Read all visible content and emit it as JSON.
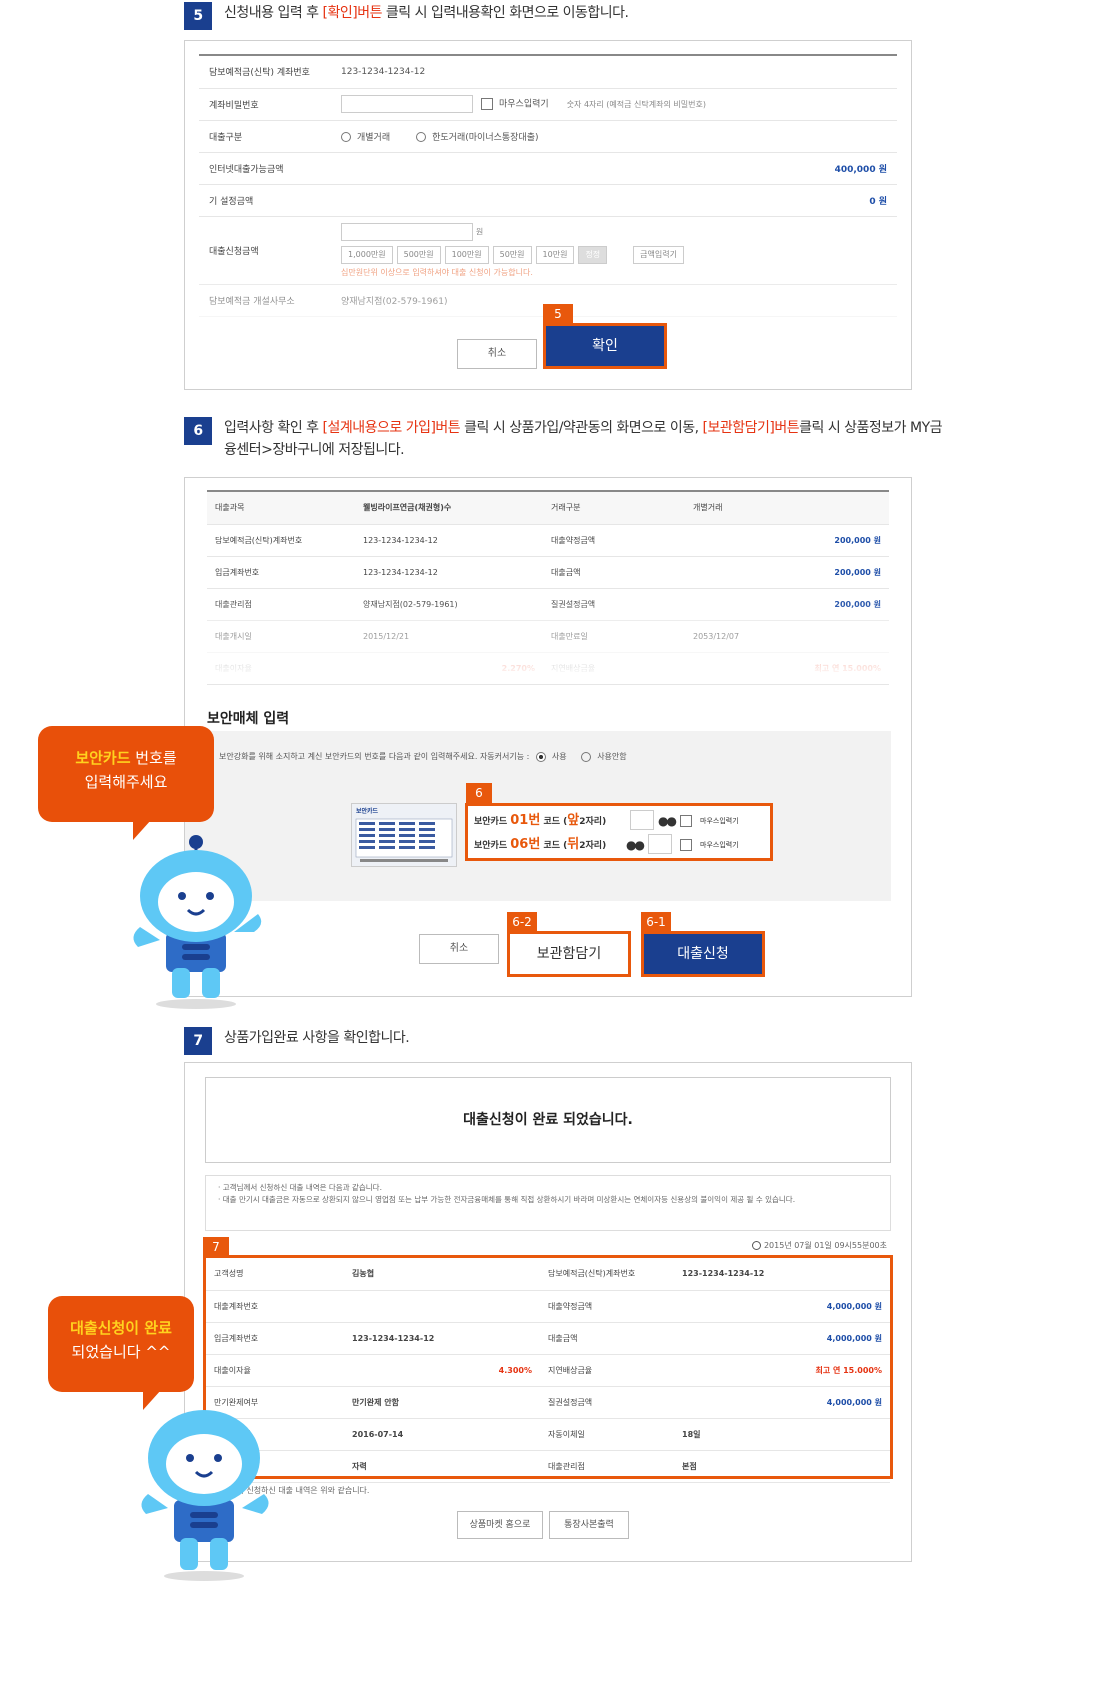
{
  "step5": {
    "num": "5",
    "text_before": "신청내용 입력 후 ",
    "text_highlight": "[확인]버튼",
    "text_after": " 클릭 시 입력내용확인 화면으로 이동합니다."
  },
  "form5": {
    "rows": [
      {
        "label": "담보예적금(신탁) 계좌번호",
        "value": "123-1234-1234-12"
      },
      {
        "label": "계좌비밀번호",
        "mouse": "마우스입력기",
        "hint": "숫자 4자리 (예적금 신탁계좌의 비밀번호)"
      },
      {
        "label": "대출구분",
        "opt1": "개별거래",
        "opt2": "한도거래(마이너스통장대출)"
      },
      {
        "label": "인터넷대출가능금액",
        "value": "400,000 원"
      },
      {
        "label": "기 설정금액",
        "value": "0 원"
      },
      {
        "label": "대출신청금액",
        "unit": "원",
        "amounts": [
          "1,000만원",
          "500만원",
          "100만원",
          "50만원",
          "10만원",
          "정정"
        ],
        "amount_input": "금액입력기",
        "note": "십만원단위 이상으로 입력하셔야 대출 신청이 가능합니다."
      },
      {
        "label": "담보예적금 개설사무소",
        "value": "양재남지점(02-579-1961)"
      }
    ],
    "tag": "5",
    "cancel": "취소",
    "confirm": "확인"
  },
  "step6": {
    "num": "6",
    "t1": "입력사항 확인 후 ",
    "h1": "[설계내용으로 가입]버튼",
    "t2": " 클릭 시 상품가입/약관동의 화면으로 이동, ",
    "h2": "[보관함담기]버튼",
    "t3": "클릭 시 상품정보가 MY금융센터>장바구니에 저장됩니다."
  },
  "form6": {
    "rows": [
      [
        "대출과목",
        "웰빙라이프연금(채권형)수",
        "거래구분",
        "개별거래"
      ],
      [
        "담보예적금(신탁)계좌번호",
        "123-1234-1234-12",
        "대출약정금액",
        "200,000 원"
      ],
      [
        "입금계좌번호",
        "123-1234-1234-12",
        "대출금액",
        "200,000 원"
      ],
      [
        "대출관리점",
        "양재남지점(02-579-1961)",
        "질권설정금액",
        "200,000 원"
      ],
      [
        "대출개시일",
        "2015/12/21",
        "대출만료일",
        "2053/12/07"
      ],
      [
        "대출이자율",
        "2.270%",
        "지연배상금율",
        "최고 연 15.000%"
      ]
    ],
    "security_title": "보안매체 입력",
    "security_desc": "보안강화를 위해 소지하고 계신 보안카드의 번호를 다음과 같이 입력해주세요. 자동커서기능 :",
    "opt_use": "사용",
    "opt_nouse": "사용안함",
    "card_title": "보안카드",
    "tag6": "6",
    "line1": {
      "a": "보안카드 ",
      "num": "01번",
      "b": " 코드 (",
      "pos": "앞",
      "c": "2자리)"
    },
    "line2": {
      "a": "보안카드 ",
      "num": "06번",
      "b": " 코드 (",
      "pos": "뒤",
      "c": "2자리)"
    },
    "mouse": "마우스입력기",
    "tag62": "6-2",
    "tag61": "6-1",
    "cancel": "취소",
    "save": "보관함담기",
    "apply": "대출신청"
  },
  "bubble1": {
    "hl": "보안카드",
    "t1": " 번호를",
    "t2": "입력해주세요"
  },
  "step7": {
    "num": "7",
    "text": "상품가입완료 사항을 확인합니다."
  },
  "form7": {
    "done": "대출신청이 완료 되었습니다.",
    "notes": [
      "· 고객님께서 신청하신 대출 내역은 다음과 같습니다.",
      "· 대출 만기시 대출금은 자동으로 상환되지 않으니 영업점 또는 납부 가능한 전자금융매체를 통해 직접 상환하시기 바라며 미상환시는 연체이자등 신용상의 불이익이 제공 될 수 있습니다."
    ],
    "tag7": "7",
    "timestamp": "2015년 07월 01일 09시55분00초",
    "rows": [
      [
        "고객성명",
        "김농협",
        "담보예적금(신탁)계좌번호",
        "123-1234-1234-12"
      ],
      [
        "대출계좌번호",
        "",
        "대출약정금액",
        "4,000,000 원"
      ],
      [
        "입금계좌번호",
        "123-1234-1234-12",
        "대출금액",
        "4,000,000 원"
      ],
      [
        "대출이자율",
        "4.300%",
        "지연배상금율",
        "최고 연 15.000%"
      ],
      [
        "만기완제여부",
        "만기완제 안함",
        "질권설정금액",
        "4,000,000 원"
      ],
      [
        "대출만료일",
        "2016-07-14",
        "자동이체일",
        "18일"
      ],
      [
        "상환방법",
        "자력",
        "대출관리점",
        "본점"
      ]
    ],
    "footer_note": "고객님께서 신청하신 대출 내역은 위와 같습니다.",
    "btn_home": "상품마켓 홈으로",
    "btn_print": "통장사본출력"
  },
  "bubble2": {
    "hl": "대출신청이 완료",
    "t2": "되었습니다 ^^"
  },
  "colors": {
    "accent": "#e8580c",
    "primary": "#1a3f8f",
    "highlight": "#e63312",
    "value_blue": "#1e4ea8"
  }
}
